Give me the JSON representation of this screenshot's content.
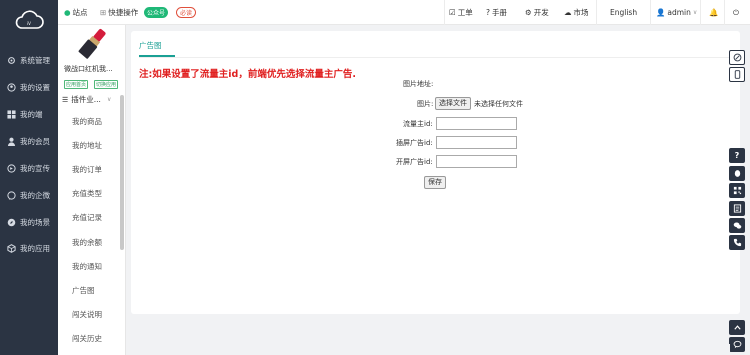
{
  "sidebar": {
    "items": [
      {
        "label": "系统管理",
        "icon": "gear-icon"
      },
      {
        "label": "我的设置",
        "icon": "user-settings-icon"
      },
      {
        "label": "我的端",
        "icon": "grid-icon"
      },
      {
        "label": "我的会员",
        "icon": "person-icon"
      },
      {
        "label": "我的宣传",
        "icon": "megaphone-icon"
      },
      {
        "label": "我的企微",
        "icon": "chat-icon"
      },
      {
        "label": "我的场景",
        "icon": "compass-icon"
      },
      {
        "label": "我的应用",
        "icon": "cube-icon"
      }
    ]
  },
  "app": {
    "name": "微战口红机我...",
    "tag1": "应用首页",
    "tag2": "切换应用",
    "plugin_label": "插件业..."
  },
  "sub_menu": [
    "我的商品",
    "我的地址",
    "我的订单",
    "充值类型",
    "充值记录",
    "我的余额",
    "我的通知",
    "广告图",
    "闯关说明",
    "闯关历史"
  ],
  "topbar": {
    "site": "站点",
    "quick": "快捷操作",
    "badge_green": "公众号",
    "badge_red": "必读",
    "ticket": "工单",
    "manual": "手册",
    "dev": "开发",
    "market": "市场",
    "lang": "English",
    "user": "admin"
  },
  "content": {
    "tab": "广告图",
    "warning": "注:如果设置了流量主id，前端优先选择流量主广告.",
    "image_addr_label": "图片地址:",
    "image_label": "图片:",
    "file_button": "选择文件",
    "no_file": "未选择任何文件",
    "traffic_id_label": "流量主id:",
    "interstitial_label": "插屏广告id:",
    "splash_label": "开屏广告id:",
    "save": "保存"
  },
  "colors": {
    "sidebar_bg": "#2b3443",
    "accent": "#1aa094",
    "warning": "#e02020",
    "badge_green": "#1fb877"
  }
}
